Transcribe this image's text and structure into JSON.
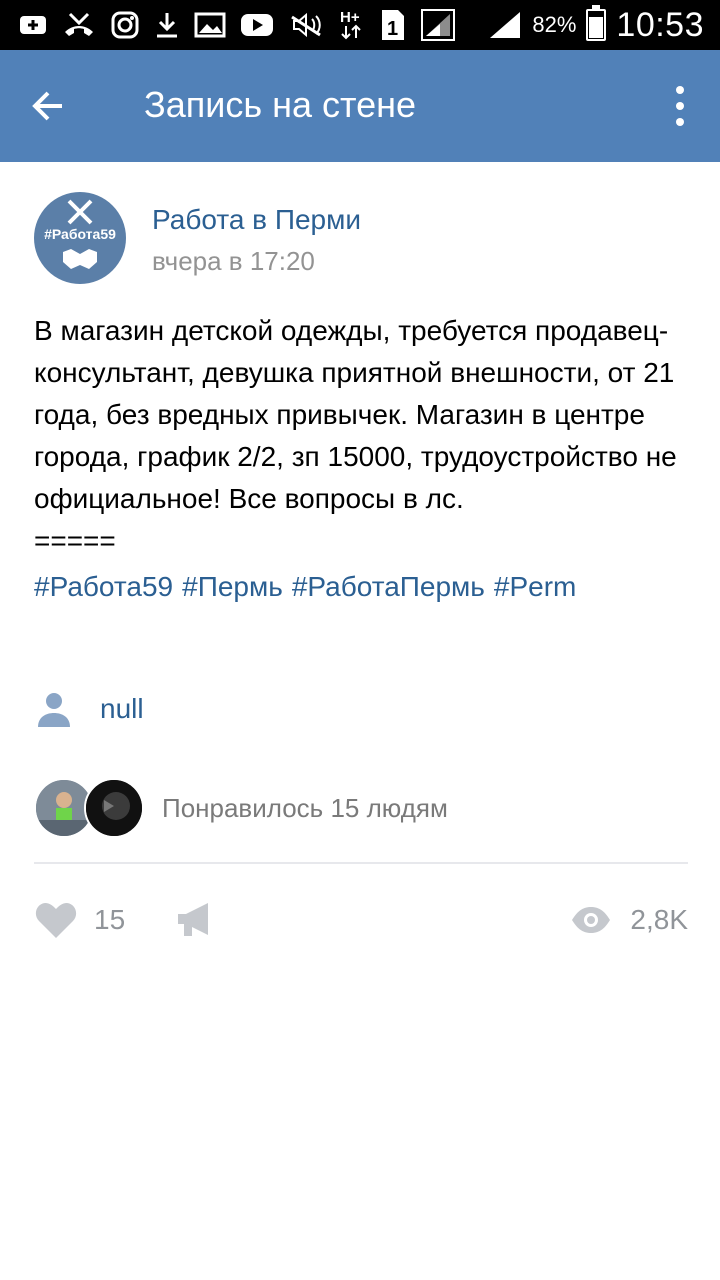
{
  "status_bar": {
    "time": "10:53",
    "battery": "82%",
    "battery_level": 0.82,
    "icons": [
      "plus-icon",
      "missed-call-icon",
      "instagram-icon",
      "download-icon",
      "image-icon",
      "youtube-icon",
      "mute-icon",
      "network-h-plus-icon",
      "sim-1-icon",
      "signal-icon",
      "signal-icon",
      "battery-icon"
    ]
  },
  "app_bar": {
    "title": "Запись на стене",
    "back_icon": "arrow-back-icon",
    "menu_icon": "more-vert-icon",
    "color": "#5181b8"
  },
  "post": {
    "author": "Работа в Перми",
    "time": "вчера в 17:20",
    "avatar_text": "#Работа59",
    "text": "В магазин детской одежды, требуется продавец-консультант, девушка приятной внешности, от 21 года, без вредных привычек. Магазин в центре города, график 2/2, зп 15000, трудоустройство не официальное! Все вопросы в лс.\n=====",
    "hashtags": [
      "#Работа59",
      "#Пермь",
      "#РаботаПермь",
      "#Perm"
    ],
    "signer": "null",
    "likes_text": "Понравилось 15 людям",
    "like_count": "15",
    "views": "2,8K"
  },
  "colors": {
    "link": "#2b5f92",
    "muted": "#909499",
    "accent": "#5181b8"
  }
}
